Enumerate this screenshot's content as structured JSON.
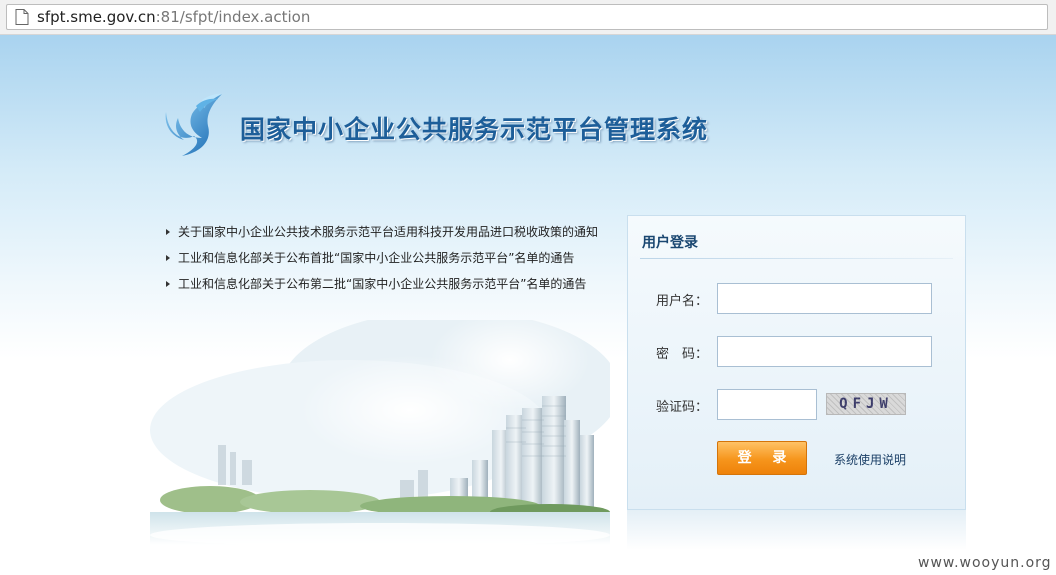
{
  "browser": {
    "url_host": "sfpt.sme.gov.cn",
    "url_rest": ":81/sfpt/index.action"
  },
  "header": {
    "title": "国家中小企业公共服务示范平台管理系统",
    "logo_icon": "wing-logo-icon"
  },
  "news": [
    {
      "text": "关于国家中小企业公共技术服务示范平台适用科技开发用品进口税收政策的通知"
    },
    {
      "text": "工业和信息化部关于公布首批“国家中小企业公共服务示范平台”名单的通告"
    },
    {
      "text": "工业和信息化部关于公布第二批“国家中小企业公共服务示范平台”名单的通告"
    }
  ],
  "login": {
    "title": "用户登录",
    "username_label": "用户名：",
    "password_label": "密　码：",
    "captcha_label": "验证码：",
    "username_value": "",
    "password_value": "",
    "captcha_value": "",
    "captcha_text": "QFJW",
    "submit_label": "登 录",
    "help_link": "系统使用说明"
  },
  "watermark": "www.wooyun.org",
  "colors": {
    "title_blue": "#1d5e99",
    "button_orange": "#f6951c",
    "sky_blue": "#a9d3ef"
  }
}
